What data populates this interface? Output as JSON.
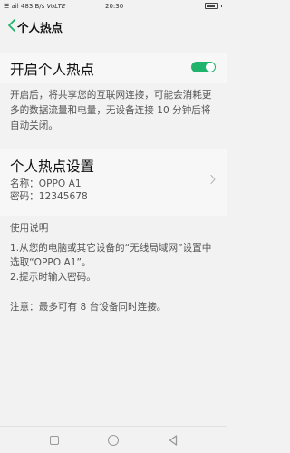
{
  "status_bar": {
    "signal_text": "☰ ail",
    "speed": "483 B/s",
    "network": "VoLTE",
    "time": "20:30"
  },
  "header": {
    "title": "个人热点"
  },
  "hotspot_toggle": {
    "label": "开启个人热点",
    "enabled": true,
    "accent_color": "#1fb36b"
  },
  "description": "开启后，将共享您的互联网连接，可能会消耗更多的数据流量和电量，无设备连接 10 分钟后将自动关闭。",
  "settings": {
    "title": "个人热点设置",
    "name_line": "名称：OPPO A1",
    "password_line": "密码：12345678"
  },
  "help": {
    "heading": "使用说明",
    "step1": "1.从您的电脑或其它设备的“无线局域网”设置中选取“OPPO A1”。",
    "step2": "2.提示时输入密码。",
    "note": "注意：最多可有 8 台设备同时连接。"
  },
  "icons": {
    "back": "chevron-left-icon",
    "settings_arrow": "chevron-right-icon",
    "nav_recent": "square-icon",
    "nav_home": "circle-icon",
    "nav_back": "triangle-back-icon"
  }
}
